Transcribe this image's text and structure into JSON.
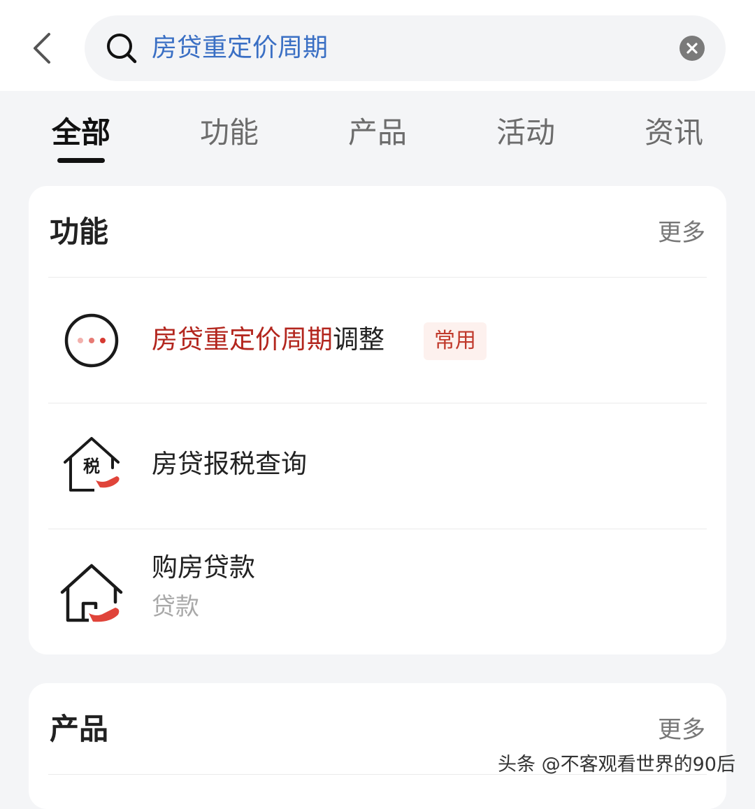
{
  "search": {
    "query": "房贷重定价周期"
  },
  "tabs": [
    {
      "label": "全部",
      "active": true
    },
    {
      "label": "功能",
      "active": false
    },
    {
      "label": "产品",
      "active": false
    },
    {
      "label": "活动",
      "active": false
    },
    {
      "label": "资讯",
      "active": false
    }
  ],
  "functions_section": {
    "title": "功能",
    "more_label": "更多",
    "items": [
      {
        "label_highlight": "房贷重定价周期",
        "label_rest": "调整",
        "badge": "常用",
        "icon": "more-dots-icon"
      },
      {
        "label": "房贷报税查询",
        "icon": "house-tax-icon",
        "icon_text": "税"
      },
      {
        "label": "购房贷款",
        "sub": "贷款",
        "icon": "house-loan-icon"
      }
    ]
  },
  "products_section": {
    "title": "产品",
    "more_label": "更多"
  },
  "watermark": "头条 @不客观看世界的90后",
  "colors": {
    "highlight": "#b3261e",
    "search_text": "#3a6fc4",
    "icon_accent": "#e0443a",
    "background": "#f4f5f7"
  }
}
